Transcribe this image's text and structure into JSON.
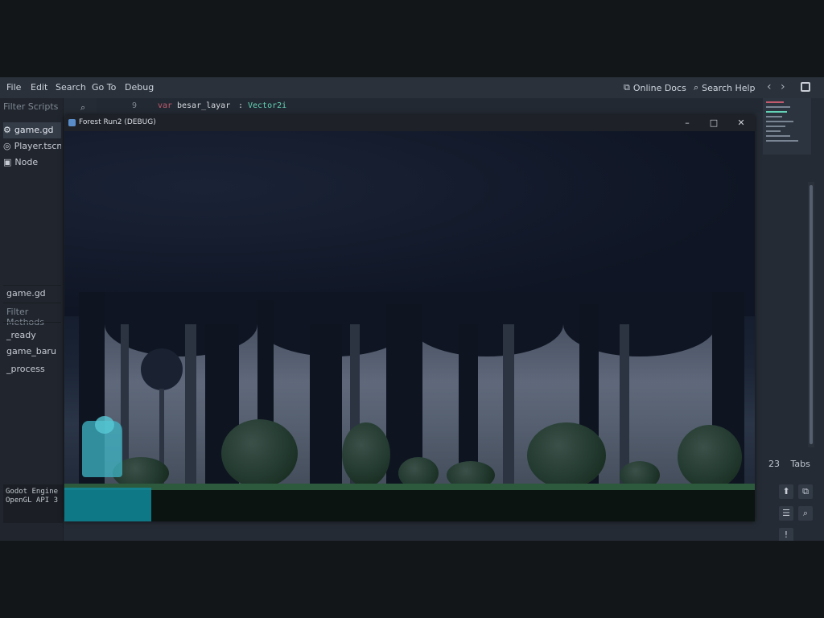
{
  "menubar": {
    "items": [
      "File",
      "Edit",
      "Search",
      "Go To",
      "Debug"
    ],
    "online_docs": "Online Docs",
    "search_help": "Search Help",
    "nav_back": "‹",
    "nav_forward": "›"
  },
  "left_panel": {
    "filter_scripts": "Filter Scripts",
    "scripts": [
      {
        "label": "game.gd",
        "icon": "gear-icon",
        "active": true
      },
      {
        "label": "Player.tscn",
        "icon": "scene-icon",
        "active": false
      },
      {
        "label": "Node",
        "icon": "node-icon",
        "active": false
      }
    ],
    "current_script": "game.gd",
    "filter_methods": "Filter Methods",
    "methods": [
      "_ready",
      "game_baru",
      "_process"
    ],
    "output_lines": [
      "Godot Engine",
      "OpenGL API 3"
    ]
  },
  "code": {
    "line_number": "9",
    "keyword": "var",
    "identifier": "besar_layar",
    "colon": ":",
    "type": "Vector2i"
  },
  "right_panel": {
    "tabs_count": "23",
    "tabs_label": "Tabs"
  },
  "game_window": {
    "title": "Forest Run2 (DEBUG)",
    "minimize": "–",
    "maximize": "□",
    "close": "✕"
  },
  "colors": {
    "editor_bg": "#252b34",
    "keyword": "#c05b6e",
    "type": "#63d2b6",
    "player": "#3fb6c6"
  }
}
